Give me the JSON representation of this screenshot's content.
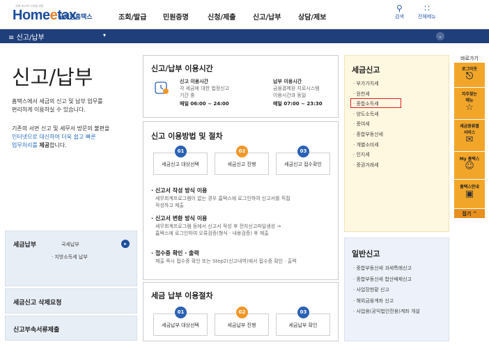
{
  "logo": {
    "tagline": "세계 최고의 디지털 세정",
    "home": "Home",
    "e": "e",
    "tax": "tax",
    "korean": "국세청홈택스"
  },
  "nav": [
    "조회/발급",
    "민원증명",
    "신청/제출",
    "신고/납부",
    "상담/제보"
  ],
  "search": {
    "icon": "search-icon",
    "label": "검색"
  },
  "allmenu": {
    "icon": "grid-icon",
    "label": "전체메뉴"
  },
  "subbar": {
    "title": "신고/납부",
    "menu_icon": "menu-icon",
    "dropdown_icon": "caret-down-icon",
    "circle_icon": "chevron-down-icon"
  },
  "page": {
    "title": "신고/납부",
    "desc1_a": "홈택스에서 세금의 신고 및 납부 업무를",
    "desc1_b": "편리하게 이용하실 수 있습니다.",
    "desc2_a": "기존의 서면 신고 및 세무서 방문의 불편을",
    "desc2_link_a": "인터넷으로 대신하여 더욱 쉽고 빠른",
    "desc2_link_b": "업무처리를",
    "desc2_bold": "제공",
    "desc2_end": "합니다."
  },
  "left": {
    "payment": {
      "title": "세금납부",
      "items": [
        "국세납부",
        "· 지방소득세 납부"
      ],
      "circle_icon": "chevron-right-icon"
    },
    "delete": "세금신고 삭제요청",
    "attach": "신고부속서류제출"
  },
  "hours": {
    "title": "신고/납부 이용시간",
    "clock_icon": "clock-icon",
    "report_title": "신고 이용시간",
    "report_desc_a": "각 세금에 대한 법정신고",
    "report_desc_b": "기간 중",
    "report_time": "매일 06:00 ~ 24:00",
    "pay_title": "납부 이용시간",
    "pay_desc_a": "금융결제원 지로시스템",
    "pay_desc_b": "이용시간과 동일",
    "pay_time": "매일 07:00 ~ 23:30"
  },
  "process": {
    "title": "신고 이용방법 및 절차",
    "steps": [
      {
        "num": "01",
        "label": "세금신고 대상선택"
      },
      {
        "num": "02",
        "label": "세금신고 진행"
      },
      {
        "num": "03",
        "label": "세금신고 접수확인"
      }
    ],
    "b1_title": "· 신고서 작성 방식 이용",
    "b1_a": "세무회계프로그램이 없는 경우 홈택스에 로그인하여 신고서를 직접",
    "b1_b": "작성하고 제출",
    "b2_title": "· 신고서 변환 방식 이용",
    "b2_a": "세무회계프로그램 등에서 신고서 작성 후 전자신고파일생성 →",
    "b2_b": "홈택스에 로그인하여 오류검증(형식 · 내용검증) 후 제출",
    "b3_title": "· 접수증 확인 · 출력",
    "b3_a": "제출 즉시 접수증 확인 또는 Step2(신고내역)에서 접수증 확인 · 출력"
  },
  "payproc": {
    "title": "세금 납부 이용절차",
    "steps": [
      {
        "num": "01",
        "label": "세금납부 대상선택"
      },
      {
        "num": "02",
        "label": "세금납부 진행"
      },
      {
        "num": "03",
        "label": "세금납부 확인"
      }
    ]
  },
  "taxreport": {
    "title": "세금신고",
    "items": [
      "· 부가가치세",
      "· 원천세",
      "· 종합소득세",
      "· 양도소득세",
      "· 증여세",
      "· 종합부동산세",
      "· 개별소비세",
      "· 인지세",
      "· 증권거래세"
    ]
  },
  "general": {
    "title": "일반신고",
    "items": [
      "· 종합부동산세 과세특례신고",
      "· 종합부동산세 합산배제신고",
      "· 사업장현황 신고",
      "· 해외금융계좌 신고",
      "· 사업용(공익법인전용)계좌 개설"
    ]
  },
  "side": {
    "title": "바로가기",
    "logout": "로그아웃",
    "fav_a": "자주찾는",
    "fav_b": "메뉴",
    "svc_a": "세금종류별",
    "svc_b": "서비스",
    "my": "My 홈택스",
    "guide": "홈택스안내",
    "close": "접기 ^"
  },
  "colors": {
    "accent": "#f2a629",
    "navy": "#1f3f7a",
    "blue": "#2a61b5",
    "orange": "#f29727",
    "highlight": "#e02020"
  }
}
